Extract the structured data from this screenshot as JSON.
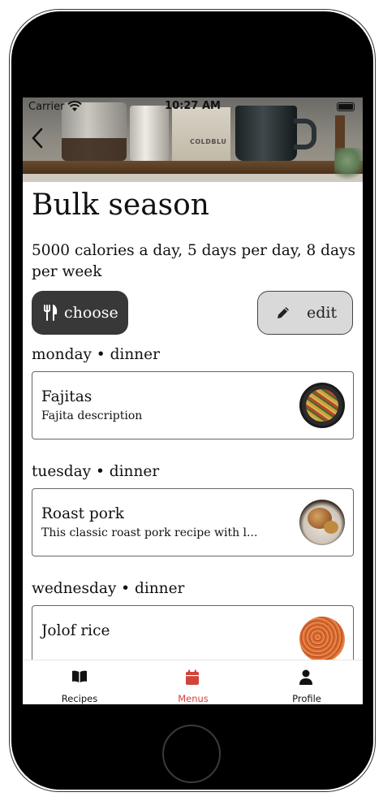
{
  "status_bar": {
    "carrier": "Carrier",
    "time": "10:27 AM"
  },
  "hero": {
    "bag_label": "COLDBLU"
  },
  "menu": {
    "title": "Bulk season",
    "description": "5000 calories a day, 5 days per day, 8 days per week",
    "choose_label": "choose",
    "edit_label": "edit"
  },
  "meals": [
    {
      "day": "monday • dinner",
      "name": "Fajitas",
      "description": "Fajita description",
      "thumb": "fajitas-photo"
    },
    {
      "day": "tuesday • dinner",
      "name": "Roast pork",
      "description": "This classic roast pork recipe with l...",
      "thumb": "roast-pork-photo"
    },
    {
      "day": "wednesday • dinner",
      "name": "Jolof rice",
      "description": "",
      "thumb": "jolof-rice-photo"
    }
  ],
  "tabbar": {
    "items": [
      {
        "label": "Recipes",
        "icon": "book-icon"
      },
      {
        "label": "Menus",
        "icon": "calendar-icon"
      },
      {
        "label": "Profile",
        "icon": "person-icon"
      }
    ],
    "active": "Menus",
    "active_color": "#d0443a",
    "inactive_color": "#111111"
  },
  "colors": {
    "choose_bg": "#383838",
    "edit_bg": "#d9d9d9"
  }
}
